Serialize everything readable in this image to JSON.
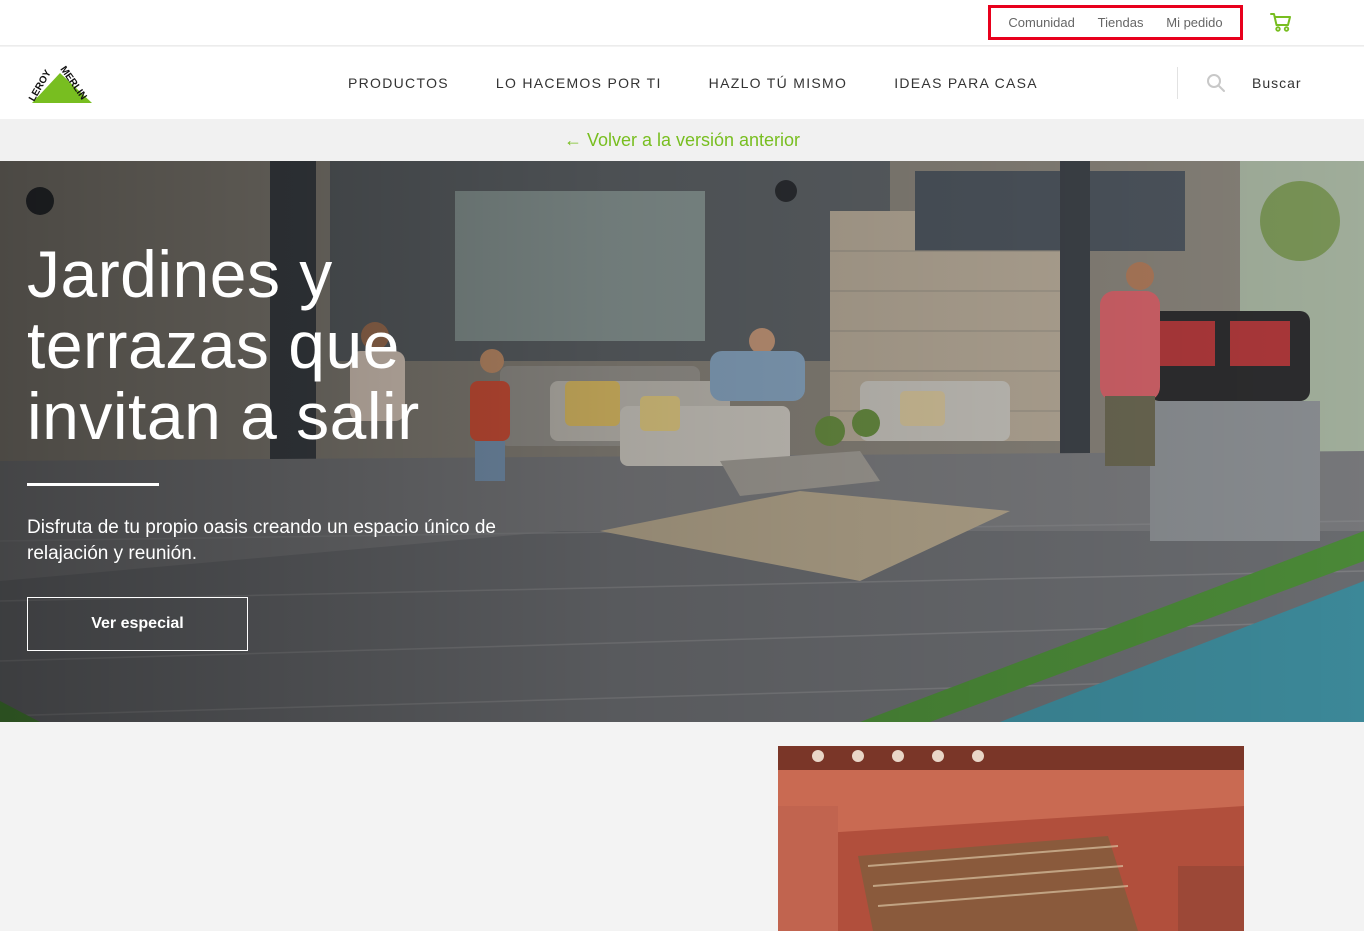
{
  "topbar": {
    "links": [
      "Comunidad",
      "Tiendas",
      "Mi pedido"
    ],
    "cart_icon": "cart-icon",
    "highlight_color": "#e8001c"
  },
  "brand": {
    "logo_text_1": "LEROY",
    "logo_text_2": "MERLIN",
    "color": "#78be20"
  },
  "nav": {
    "items": [
      "PRODUCTOS",
      "LO HACEMOS POR TI",
      "HAZLO TÚ MISMO",
      "IDEAS PARA CASA"
    ],
    "search_label": "Buscar",
    "search_icon": "search-icon"
  },
  "backbar": {
    "label": "← Volver a la versión anterior"
  },
  "hero": {
    "title": "Jardines y terrazas que invitan a salir",
    "subtitle": "Disfruta de tu propio oasis creando un espacio único de relajación y reunión.",
    "button": "Ver especial"
  }
}
